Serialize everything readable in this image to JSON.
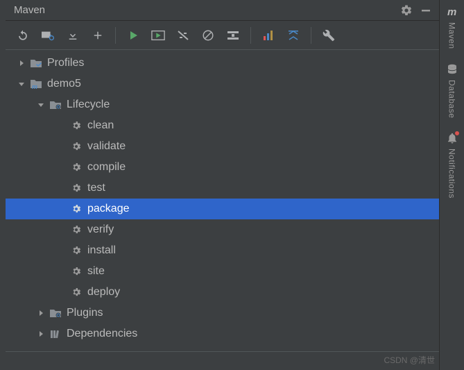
{
  "title": "Maven",
  "watermark": "CSDN @清世",
  "side_tabs": {
    "maven": "Maven",
    "database": "Database",
    "notifications": "Notifications"
  },
  "tree": {
    "profiles": "Profiles",
    "project": "demo5",
    "lifecycle": "Lifecycle",
    "goals": {
      "clean": "clean",
      "validate": "validate",
      "compile": "compile",
      "test": "test",
      "package": "package",
      "verify": "verify",
      "install": "install",
      "site": "site",
      "deploy": "deploy"
    },
    "plugins": "Plugins",
    "dependencies": "Dependencies"
  }
}
